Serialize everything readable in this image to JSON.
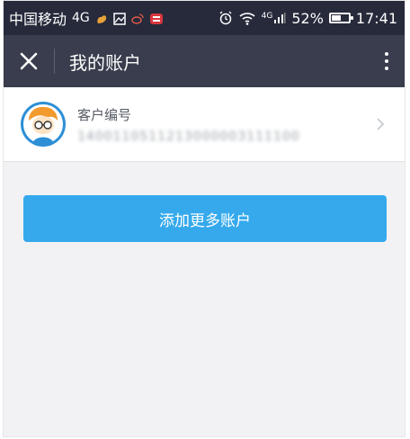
{
  "status_bar": {
    "carrier": "中国移动",
    "network": "4G",
    "signal_network": "4G",
    "battery": "52%",
    "battery_level": 0.52,
    "time": "17:41",
    "icons": [
      "squirrel-icon",
      "image-icon",
      "weibo-icon",
      "app-badge-icon",
      "alarm-icon",
      "wifi-icon",
      "signal-icon",
      "battery-icon"
    ]
  },
  "app_bar": {
    "title": "我的账户",
    "close_icon": "close-icon",
    "more_icon": "more-vertical-icon"
  },
  "account": {
    "label": "客户编号",
    "number": "1400110511213000003111100"
  },
  "actions": {
    "add_more": "添加更多账户"
  },
  "colors": {
    "status_bar": "#262a3b",
    "app_bar": "#393d4d",
    "background": "#f2f2f4",
    "button": "#35a9ec"
  }
}
